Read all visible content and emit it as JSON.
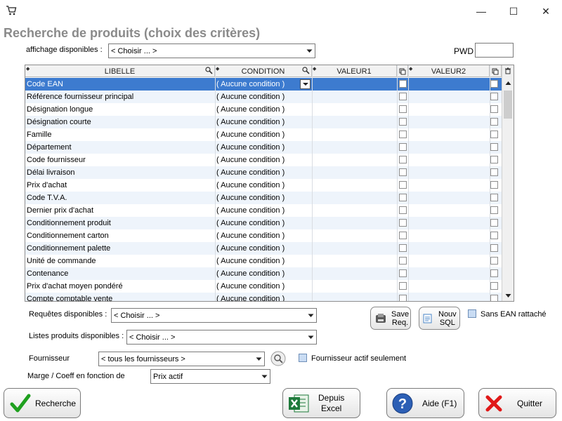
{
  "window": {
    "minimize_glyph": "—",
    "maximize_glyph": "☐",
    "close_glyph": "✕"
  },
  "page_title": "Recherche de produits (choix des critères)",
  "affichage": {
    "label": "affichage disponibles :",
    "value": "< Choisir ... >"
  },
  "pwd": {
    "label": "PWD",
    "value": ""
  },
  "grid": {
    "columns": [
      "LIBELLE",
      "CONDITION",
      "VALEUR1",
      "VALEUR2"
    ],
    "rows": [
      {
        "libelle": "Code EAN",
        "condition": "( Aucune condition )"
      },
      {
        "libelle": "Référence fournisseur principal",
        "condition": "( Aucune condition )"
      },
      {
        "libelle": "Désignation longue",
        "condition": "( Aucune condition )"
      },
      {
        "libelle": "Désignation courte",
        "condition": "( Aucune condition )"
      },
      {
        "libelle": "Famille",
        "condition": "( Aucune condition )"
      },
      {
        "libelle": "Département",
        "condition": "( Aucune condition )"
      },
      {
        "libelle": "Code fournisseur",
        "condition": "( Aucune condition )"
      },
      {
        "libelle": "Délai livraison",
        "condition": "( Aucune condition )"
      },
      {
        "libelle": "Prix d'achat",
        "condition": "( Aucune condition )"
      },
      {
        "libelle": "Code T.V.A.",
        "condition": "( Aucune condition )"
      },
      {
        "libelle": "Dernier prix d'achat",
        "condition": "( Aucune condition )"
      },
      {
        "libelle": "Conditionnement produit",
        "condition": "( Aucune condition )"
      },
      {
        "libelle": "Conditionnement carton",
        "condition": "( Aucune condition )"
      },
      {
        "libelle": "Conditionnement palette",
        "condition": "( Aucune condition )"
      },
      {
        "libelle": "Unité de commande",
        "condition": "( Aucune condition )"
      },
      {
        "libelle": "Contenance",
        "condition": "( Aucune condition )"
      },
      {
        "libelle": "Prix d'achat moyen pondéré",
        "condition": "( Aucune condition )"
      },
      {
        "libelle": "Compte comptable vente",
        "condition": "( Aucune condition )"
      }
    ]
  },
  "requetes": {
    "label": "Requêtes disponibles :",
    "value": "< Choisir ... >"
  },
  "listes": {
    "label": "Listes produits disponibles :",
    "value": "< Choisir ... >"
  },
  "fournisseur": {
    "label": "Fournisseur",
    "value": "< tous les fournisseurs >"
  },
  "marge": {
    "label": "Marge / Coeff en fonction de",
    "value": "Prix actif"
  },
  "buttons": {
    "save_req": [
      "Save",
      "Req."
    ],
    "nouv_sql": [
      "Nouv",
      "SQL"
    ],
    "recherche": "Recherche",
    "depuis_excel": [
      "Depuis",
      "Excel"
    ],
    "aide": "Aide (F1)",
    "quitter": "Quitter"
  },
  "checkboxes": {
    "sans_ean": "Sans EAN rattaché",
    "fournisseur_actif": "Fournisseur actif seulement"
  },
  "colors": {
    "selection": "#3d7bcf",
    "row_alt": "#eef4fb",
    "title_gray": "#8a8a8a"
  }
}
